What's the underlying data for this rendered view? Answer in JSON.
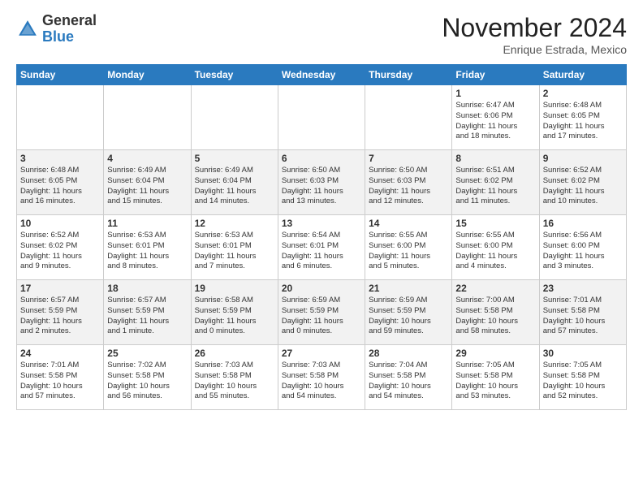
{
  "header": {
    "logo_general": "General",
    "logo_blue": "Blue",
    "month_title": "November 2024",
    "subtitle": "Enrique Estrada, Mexico"
  },
  "days_of_week": [
    "Sunday",
    "Monday",
    "Tuesday",
    "Wednesday",
    "Thursday",
    "Friday",
    "Saturday"
  ],
  "weeks": [
    [
      {
        "day": "",
        "info": ""
      },
      {
        "day": "",
        "info": ""
      },
      {
        "day": "",
        "info": ""
      },
      {
        "day": "",
        "info": ""
      },
      {
        "day": "",
        "info": ""
      },
      {
        "day": "1",
        "info": "Sunrise: 6:47 AM\nSunset: 6:06 PM\nDaylight: 11 hours\nand 18 minutes."
      },
      {
        "day": "2",
        "info": "Sunrise: 6:48 AM\nSunset: 6:05 PM\nDaylight: 11 hours\nand 17 minutes."
      }
    ],
    [
      {
        "day": "3",
        "info": "Sunrise: 6:48 AM\nSunset: 6:05 PM\nDaylight: 11 hours\nand 16 minutes."
      },
      {
        "day": "4",
        "info": "Sunrise: 6:49 AM\nSunset: 6:04 PM\nDaylight: 11 hours\nand 15 minutes."
      },
      {
        "day": "5",
        "info": "Sunrise: 6:49 AM\nSunset: 6:04 PM\nDaylight: 11 hours\nand 14 minutes."
      },
      {
        "day": "6",
        "info": "Sunrise: 6:50 AM\nSunset: 6:03 PM\nDaylight: 11 hours\nand 13 minutes."
      },
      {
        "day": "7",
        "info": "Sunrise: 6:50 AM\nSunset: 6:03 PM\nDaylight: 11 hours\nand 12 minutes."
      },
      {
        "day": "8",
        "info": "Sunrise: 6:51 AM\nSunset: 6:02 PM\nDaylight: 11 hours\nand 11 minutes."
      },
      {
        "day": "9",
        "info": "Sunrise: 6:52 AM\nSunset: 6:02 PM\nDaylight: 11 hours\nand 10 minutes."
      }
    ],
    [
      {
        "day": "10",
        "info": "Sunrise: 6:52 AM\nSunset: 6:02 PM\nDaylight: 11 hours\nand 9 minutes."
      },
      {
        "day": "11",
        "info": "Sunrise: 6:53 AM\nSunset: 6:01 PM\nDaylight: 11 hours\nand 8 minutes."
      },
      {
        "day": "12",
        "info": "Sunrise: 6:53 AM\nSunset: 6:01 PM\nDaylight: 11 hours\nand 7 minutes."
      },
      {
        "day": "13",
        "info": "Sunrise: 6:54 AM\nSunset: 6:01 PM\nDaylight: 11 hours\nand 6 minutes."
      },
      {
        "day": "14",
        "info": "Sunrise: 6:55 AM\nSunset: 6:00 PM\nDaylight: 11 hours\nand 5 minutes."
      },
      {
        "day": "15",
        "info": "Sunrise: 6:55 AM\nSunset: 6:00 PM\nDaylight: 11 hours\nand 4 minutes."
      },
      {
        "day": "16",
        "info": "Sunrise: 6:56 AM\nSunset: 6:00 PM\nDaylight: 11 hours\nand 3 minutes."
      }
    ],
    [
      {
        "day": "17",
        "info": "Sunrise: 6:57 AM\nSunset: 5:59 PM\nDaylight: 11 hours\nand 2 minutes."
      },
      {
        "day": "18",
        "info": "Sunrise: 6:57 AM\nSunset: 5:59 PM\nDaylight: 11 hours\nand 1 minute."
      },
      {
        "day": "19",
        "info": "Sunrise: 6:58 AM\nSunset: 5:59 PM\nDaylight: 11 hours\nand 0 minutes."
      },
      {
        "day": "20",
        "info": "Sunrise: 6:59 AM\nSunset: 5:59 PM\nDaylight: 11 hours\nand 0 minutes."
      },
      {
        "day": "21",
        "info": "Sunrise: 6:59 AM\nSunset: 5:59 PM\nDaylight: 10 hours\nand 59 minutes."
      },
      {
        "day": "22",
        "info": "Sunrise: 7:00 AM\nSunset: 5:58 PM\nDaylight: 10 hours\nand 58 minutes."
      },
      {
        "day": "23",
        "info": "Sunrise: 7:01 AM\nSunset: 5:58 PM\nDaylight: 10 hours\nand 57 minutes."
      }
    ],
    [
      {
        "day": "24",
        "info": "Sunrise: 7:01 AM\nSunset: 5:58 PM\nDaylight: 10 hours\nand 57 minutes."
      },
      {
        "day": "25",
        "info": "Sunrise: 7:02 AM\nSunset: 5:58 PM\nDaylight: 10 hours\nand 56 minutes."
      },
      {
        "day": "26",
        "info": "Sunrise: 7:03 AM\nSunset: 5:58 PM\nDaylight: 10 hours\nand 55 minutes."
      },
      {
        "day": "27",
        "info": "Sunrise: 7:03 AM\nSunset: 5:58 PM\nDaylight: 10 hours\nand 54 minutes."
      },
      {
        "day": "28",
        "info": "Sunrise: 7:04 AM\nSunset: 5:58 PM\nDaylight: 10 hours\nand 54 minutes."
      },
      {
        "day": "29",
        "info": "Sunrise: 7:05 AM\nSunset: 5:58 PM\nDaylight: 10 hours\nand 53 minutes."
      },
      {
        "day": "30",
        "info": "Sunrise: 7:05 AM\nSunset: 5:58 PM\nDaylight: 10 hours\nand 52 minutes."
      }
    ]
  ]
}
